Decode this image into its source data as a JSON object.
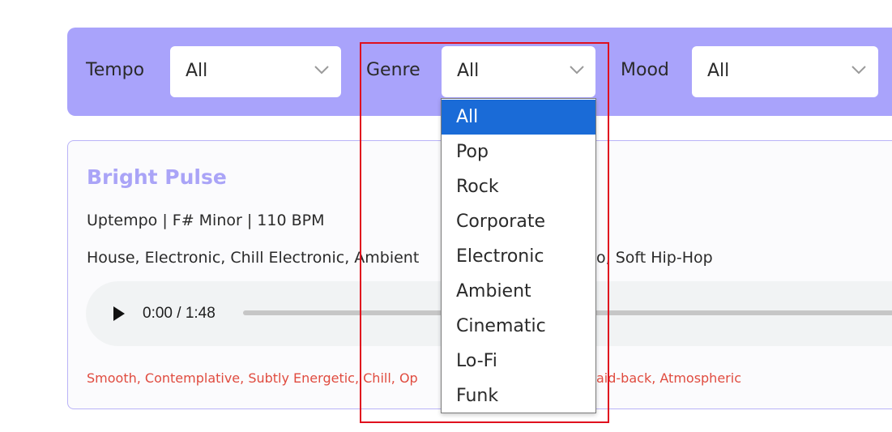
{
  "filters": {
    "tempo": {
      "label": "Tempo",
      "value": "All"
    },
    "genre": {
      "label": "Genre",
      "value": "All"
    },
    "mood": {
      "label": "Mood",
      "value": "All"
    }
  },
  "genre_dropdown": {
    "selected": "All",
    "options": [
      "All",
      "Pop",
      "Rock",
      "Corporate",
      "Electronic",
      "Ambient",
      "Cinematic",
      "Lo-Fi",
      "Funk"
    ]
  },
  "track": {
    "title": "Bright Pulse",
    "meta": "Uptempo | F# Minor | 110 BPM",
    "genres_visible_left": "House, Electronic, Chill Electronic, Ambient",
    "genres_visible_right": "o, Soft Hip-Hop",
    "audio": {
      "time": "0:00 / 1:48",
      "progress": 0
    },
    "moods_visible_left": "Smooth, Contemplative, Subtly Energetic, Chill, Op",
    "moods_visible_right": "aid-back, Atmospheric"
  },
  "colors": {
    "filter_bar": "#a9a3fb",
    "title_accent": "#aaa4f7",
    "mood_text": "#e04b3f",
    "selected_option": "#1a6bd7",
    "highlight": "#e0101e"
  },
  "icons": {
    "select_chevron": "chevron-down-icon",
    "play": "play-icon"
  }
}
